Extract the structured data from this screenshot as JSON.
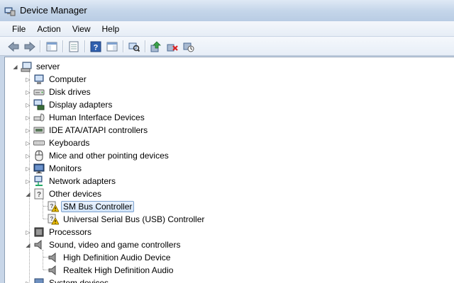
{
  "window": {
    "title": "Device Manager"
  },
  "menu": [
    "File",
    "Action",
    "View",
    "Help"
  ],
  "toolbar": {
    "buttons": [
      "back-icon",
      "forward-icon",
      "show-hide-console-tree-icon",
      "properties-icon",
      "help-icon",
      "show-action-pane-icon",
      "scan-hardware-icon",
      "update-driver-icon",
      "uninstall-icon",
      "disable-icon"
    ]
  },
  "tree": {
    "root": {
      "label": "server",
      "icon": "computer-icon",
      "expanded": true
    },
    "categories": [
      {
        "label": "Computer",
        "icon": "computer-icon",
        "expanded": false,
        "children": []
      },
      {
        "label": "Disk drives",
        "icon": "disk-drive-icon",
        "expanded": false,
        "children": []
      },
      {
        "label": "Display adapters",
        "icon": "display-adapter-icon",
        "expanded": false,
        "children": []
      },
      {
        "label": "Human Interface Devices",
        "icon": "hid-icon",
        "expanded": false,
        "children": []
      },
      {
        "label": "IDE ATA/ATAPI controllers",
        "icon": "ide-controller-icon",
        "expanded": false,
        "children": []
      },
      {
        "label": "Keyboards",
        "icon": "keyboard-icon",
        "expanded": false,
        "children": []
      },
      {
        "label": "Mice and other pointing devices",
        "icon": "mouse-icon",
        "expanded": false,
        "children": []
      },
      {
        "label": "Monitors",
        "icon": "monitor-icon",
        "expanded": false,
        "children": []
      },
      {
        "label": "Network adapters",
        "icon": "network-adapter-icon",
        "expanded": false,
        "children": []
      },
      {
        "label": "Other devices",
        "icon": "other-devices-icon",
        "expanded": true,
        "children": [
          {
            "label": "SM Bus Controller",
            "icon": "unknown-device-warning-icon",
            "selected": true
          },
          {
            "label": "Universal Serial Bus (USB) Controller",
            "icon": "unknown-device-warning-icon",
            "selected": false
          }
        ]
      },
      {
        "label": "Processors",
        "icon": "processor-icon",
        "expanded": false,
        "children": []
      },
      {
        "label": "Sound, video and game controllers",
        "icon": "speaker-icon",
        "expanded": true,
        "children": [
          {
            "label": "High Definition Audio Device",
            "icon": "speaker-icon",
            "selected": false
          },
          {
            "label": "Realtek High Definition Audio",
            "icon": "speaker-icon",
            "selected": false
          }
        ]
      },
      {
        "label": "System devices",
        "icon": "system-devices-icon",
        "expanded": false,
        "children": []
      }
    ]
  },
  "colors": {
    "selection_border": "#7da2ce",
    "selection_fill": "#d1e3f8",
    "warning": "#f2c200"
  }
}
